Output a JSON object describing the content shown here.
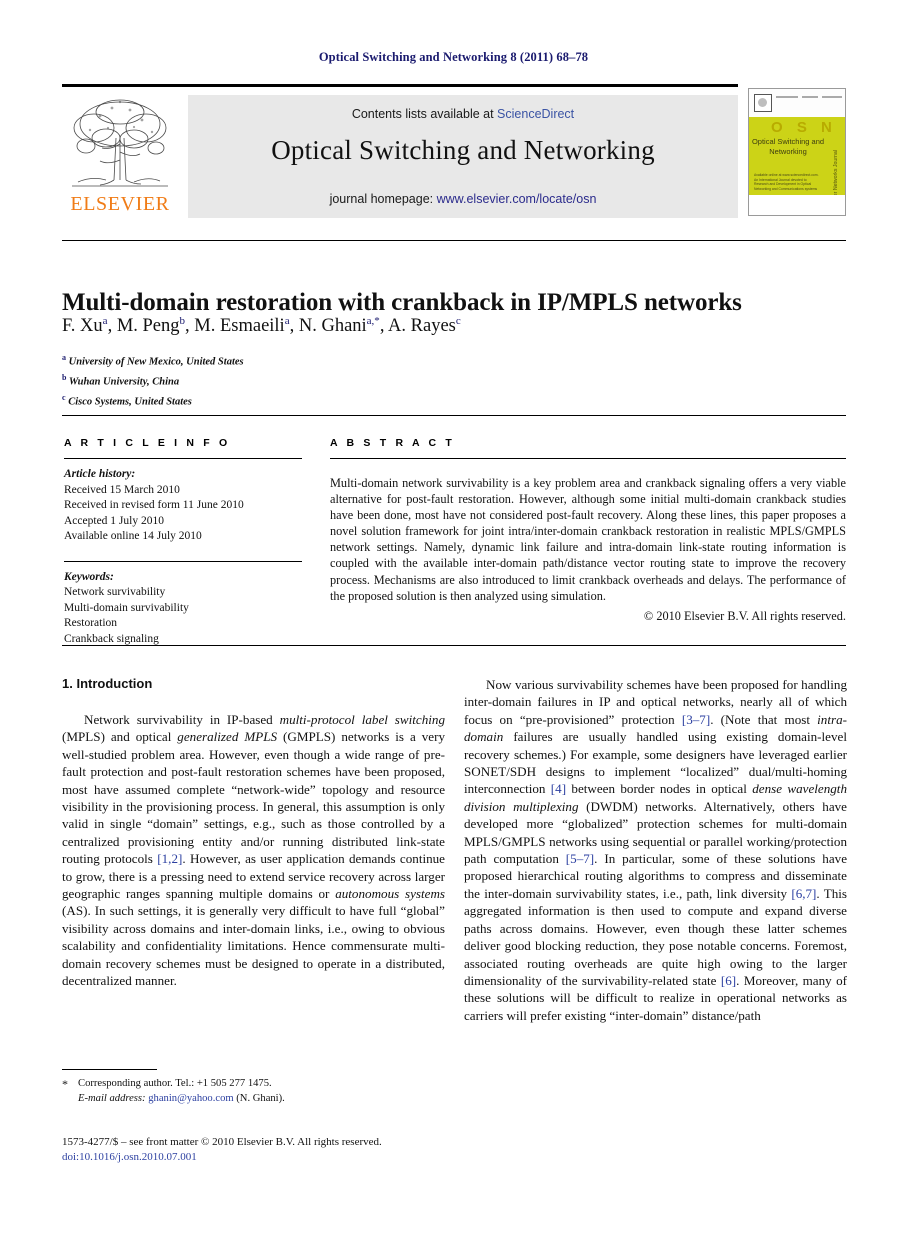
{
  "running_head": "Optical Switching and Networking 8 (2011) 68–78",
  "masthead": {
    "publisher_name": "ELSEVIER",
    "contents_prefix": "Contents lists available at ",
    "contents_link": "ScienceDirect",
    "journal_name": "Optical Switching and Networking",
    "homepage_prefix": "journal homepage: ",
    "homepage_link": "www.elsevier.com/locate/osn",
    "cover": {
      "acronym": "O S N",
      "title_lines": "Optical Switching and Networking",
      "blurb": "Available online at www.sciencedirect.com. An International Journal devoted to Research and Development in Optical Networking and Communications systems",
      "spine_text": "A Computer Networks Journal"
    },
    "colors": {
      "link_blue": "#3a53a4",
      "elsevier_orange": "#f07c17",
      "cover_yellow": "#ccd317",
      "banner_grey": "#e8e8e8",
      "runhead_navy": "#1a1a6e"
    }
  },
  "title": "Multi-domain restoration with crankback in IP/MPLS networks",
  "authors": [
    {
      "name": "F. Xu",
      "marks": "a"
    },
    {
      "name": "M. Peng",
      "marks": "b"
    },
    {
      "name": "M. Esmaeili",
      "marks": "a"
    },
    {
      "name": "N. Ghani",
      "marks": "a,*"
    },
    {
      "name": "A. Rayes",
      "marks": "c"
    }
  ],
  "affiliations": [
    {
      "mark": "a",
      "text": "University of New Mexico, United States"
    },
    {
      "mark": "b",
      "text": "Wuhan University, China"
    },
    {
      "mark": "c",
      "text": "Cisco Systems, United States"
    }
  ],
  "article_info": {
    "heading": "A R T I C L E   I N F O",
    "history_label": "Article history:",
    "history": [
      "Received 15 March 2010",
      "Received in revised form 11 June 2010",
      "Accepted 1 July 2010",
      "Available online 14 July 2010"
    ],
    "keywords_label": "Keywords:",
    "keywords": [
      "Network survivability",
      "Multi-domain survivability",
      "Restoration",
      "Crankback signaling"
    ]
  },
  "abstract": {
    "heading": "A B S T R A C T",
    "text": "Multi-domain network survivability is a key problem area and crankback signaling offers a very viable alternative for post-fault restoration. However, although some initial multi-domain crankback studies have been done, most have not considered post-fault recovery. Along these lines, this paper proposes a novel solution framework for joint intra/inter-domain crankback restoration in realistic MPLS/GMPLS network settings. Namely, dynamic link failure and intra-domain link-state routing information is coupled with the available inter-domain path/distance vector routing state to improve the recovery process. Mechanisms are also introduced to limit crankback overheads and delays. The performance of the proposed solution is then analyzed using simulation.",
    "copyright": "© 2010 Elsevier B.V. All rights reserved."
  },
  "body": {
    "section_heading": "1. Introduction",
    "left_paragraphs": [
      "Network survivability in IP-based multi-protocol label switching (MPLS) and optical generalized MPLS (GMPLS) networks is a very well-studied problem area. However, even though a wide range of pre-fault protection and post-fault restoration schemes have been proposed, most have assumed complete “network-wide” topology and resource visibility in the provisioning process. In general, this assumption is only valid in single “domain” settings, e.g., such as those controlled by a centralized provisioning entity and/or running distributed link-state routing protocols [1,2]. However, as user application demands continue to grow, there is a pressing need to extend service recovery across larger geographic ranges spanning multiple domains or autonomous systems (AS). In such settings, it is generally very difficult to have full “global” visibility across domains and inter-domain links, i.e., owing to obvious scalability and confidentiality limitations. Hence commensurate multi-domain recovery schemes must be designed to operate in a distributed, decentralized manner."
    ],
    "right_paragraphs": [
      "Now various survivability schemes have been proposed for handling inter-domain failures in IP and optical networks, nearly all of which focus on “pre-provisioned” protection [3–7]. (Note that most intra-domain failures are usually handled using existing domain-level recovery schemes.) For example, some designers have leveraged earlier SONET/SDH designs to implement “localized” dual/multi-homing interconnection [4] between border nodes in optical dense wavelength division multiplexing (DWDM) networks. Alternatively, others have developed more “globalized” protection schemes for multi-domain MPLS/GMPLS networks using sequential or parallel working/protection path computation [5–7]. In particular, some of these solutions have proposed hierarchical routing algorithms to compress and disseminate the inter-domain survivability states, i.e., path, link diversity [6,7]. This aggregated information is then used to compute and expand diverse paths across domains. However, even though these latter schemes deliver good blocking reduction, they pose notable concerns. Foremost, associated routing overheads are quite high owing to the larger dimensionality of the survivability-related state [6]. Moreover, many of these solutions will be difficult to realize in operational networks as carriers will prefer existing “inter-domain” distance/path"
    ]
  },
  "footnote": {
    "marker": "*",
    "corresponding": "Corresponding author. Tel.: +1 505 277 1475.",
    "email_label": "E-mail address:",
    "email": "ghanin@yahoo.com",
    "email_suffix": "(N. Ghani)."
  },
  "imprint": {
    "issn_line": "1573-4277/$ – see front matter © 2010 Elsevier B.V. All rights reserved.",
    "doi": "doi:10.1016/j.osn.2010.07.001"
  }
}
